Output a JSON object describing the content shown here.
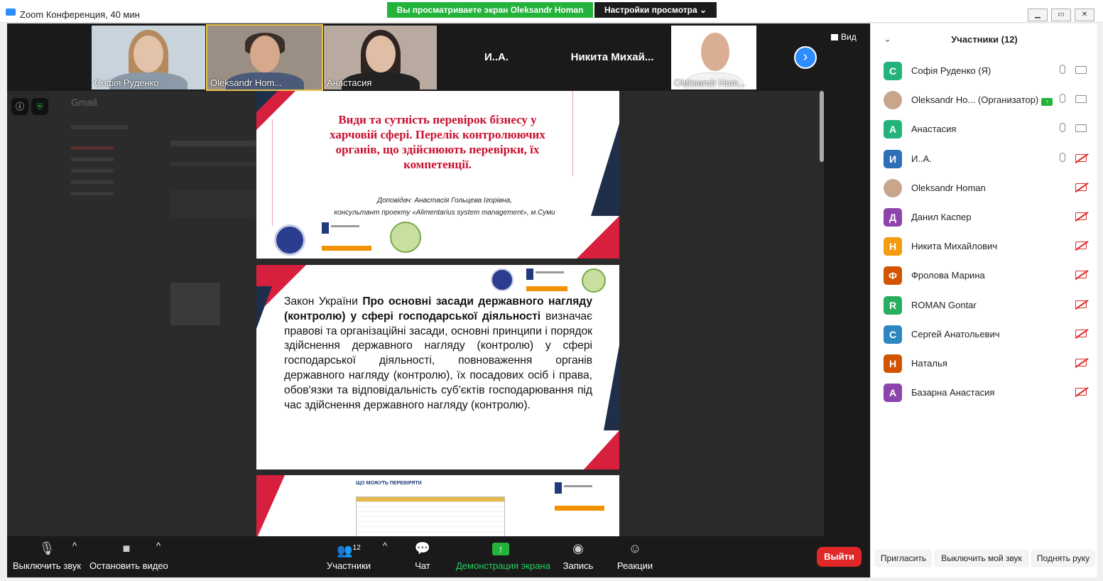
{
  "window": {
    "title": "Zoom Конференция, 40 мин",
    "share_banner": "Вы просматриваете экран Oleksandr Homan",
    "view_options": "Настройки просмотра ⌄",
    "view_button": "Вид"
  },
  "thumbnails": [
    {
      "name": "Софія Руденко"
    },
    {
      "name": "Oleksandr Hom..."
    },
    {
      "name": "Анастасия"
    },
    {
      "name": "И..А."
    },
    {
      "name": "Никита  Михай..."
    },
    {
      "name": "Oleksandr Hom..."
    }
  ],
  "shared_screen": {
    "gmail_label": "Gmail",
    "slide1": {
      "title": "Види та сутність перевірок бізнесу у харчовій сфері. Перелік контролюючих органів, що здійснюють перевірки, їх компетенції.",
      "speaker_line1": "Доповідач: Анастасія Гольцева Ігорівна,",
      "speaker_line2": "консультант проекту «Alimentarius system management», м.Суми"
    },
    "slide2": {
      "text_pre": "Закон України ",
      "text_bold": "Про основні засади державного нагляду (контролю) у сфері господарської діяльності",
      "text_post": " визначає правові та організаційні засади, основні принципи і порядок здійснення державного нагляду (контролю) у сфері господарської діяльності, повноваження органів державного нагляду (контролю), їх посадових осіб і права, обов'язки та відповідальність суб'єктів господарювання під час здійснення державного нагляду (контролю)."
    },
    "slide3": {
      "heading": "ЩО МОЖУТЬ ПЕРЕВІРЯТИ"
    }
  },
  "toolbar": {
    "mute": "Выключить звук",
    "stop_video": "Остановить видео",
    "participants": "Участники",
    "participants_count": "12",
    "chat": "Чат",
    "share_screen": "Демонстрация экрана",
    "record": "Запись",
    "reactions": "Реакции",
    "leave": "Выйти"
  },
  "panel": {
    "title": "Участники (12)",
    "participants": [
      {
        "initial": "С",
        "name": "Софія Руденко (Я)",
        "color": "#23b37a",
        "mic": true,
        "video_on": true,
        "photo": false
      },
      {
        "initial": "",
        "name": "Oleksandr Ho... (Организатор)",
        "color": "#c9a58c",
        "mic": true,
        "video_on": true,
        "photo": true,
        "host": true
      },
      {
        "initial": "А",
        "name": "Анастасия",
        "color": "#23b37a",
        "mic": true,
        "video_on": true,
        "photo": false
      },
      {
        "initial": "И",
        "name": "И..А.",
        "color": "#2d6fb8",
        "mic": true,
        "video_on": false,
        "photo": false
      },
      {
        "initial": "",
        "name": "Oleksandr Homan",
        "color": "#c9a58c",
        "mic": false,
        "video_on": false,
        "photo": true
      },
      {
        "initial": "Д",
        "name": "Данил Каспер",
        "color": "#8e44ad",
        "mic": false,
        "video_on": false,
        "photo": false
      },
      {
        "initial": "Н",
        "name": "Никита Михайлович",
        "color": "#f39c12",
        "mic": false,
        "video_on": false,
        "photo": false
      },
      {
        "initial": "Ф",
        "name": "Фролова Марина",
        "color": "#d35400",
        "mic": false,
        "video_on": false,
        "photo": false
      },
      {
        "initial": "R",
        "name": "ROMAN Gontar",
        "color": "#27ae60",
        "mic": false,
        "video_on": false,
        "photo": false
      },
      {
        "initial": "С",
        "name": "Сергей Анатольевич",
        "color": "#2e86c1",
        "mic": false,
        "video_on": false,
        "photo": false
      },
      {
        "initial": "Н",
        "name": "Наталья",
        "color": "#d35400",
        "mic": false,
        "video_on": false,
        "photo": false
      },
      {
        "initial": "А",
        "name": "Базарна Анастасия",
        "color": "#8e44ad",
        "mic": false,
        "video_on": false,
        "photo": false
      }
    ],
    "invite": "Пригласить",
    "mute_me": "Выключить мой звук",
    "raise_hand": "Поднять руку"
  }
}
